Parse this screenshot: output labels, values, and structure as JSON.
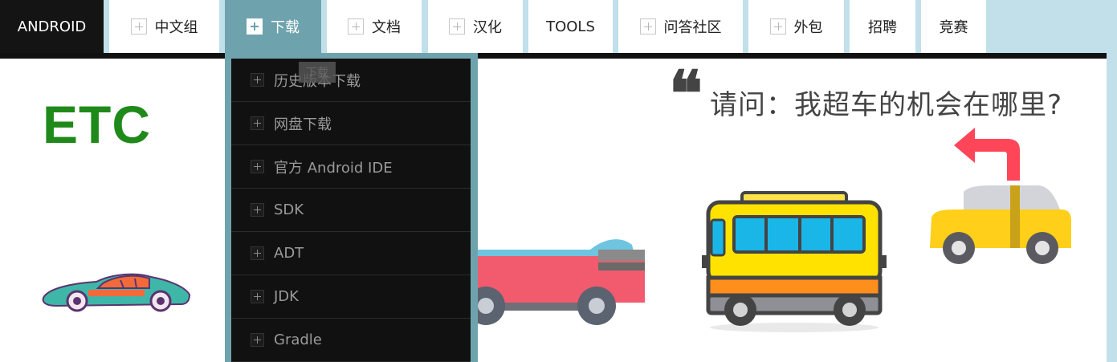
{
  "nav": {
    "brand": "ANDROID",
    "items": [
      {
        "label": "中文组",
        "icon": "plus-icon"
      },
      {
        "label": "下载",
        "icon": "plus-icon",
        "active": true
      },
      {
        "label": "文档",
        "icon": "plus-icon"
      },
      {
        "label": "汉化",
        "icon": "plus-icon"
      },
      {
        "label": "TOOLS"
      },
      {
        "label": "问答社区",
        "icon": "plus-icon"
      },
      {
        "label": "外包",
        "icon": "plus-icon"
      },
      {
        "label": "招聘"
      },
      {
        "label": "竞赛"
      }
    ]
  },
  "dropdown": {
    "tooltip": "下载",
    "items": [
      {
        "label": "历史版本下载"
      },
      {
        "label": "网盘下载"
      },
      {
        "label": "官方 Android IDE"
      },
      {
        "label": "SDK"
      },
      {
        "label": "ADT"
      },
      {
        "label": "JDK"
      },
      {
        "label": "Gradle"
      }
    ]
  },
  "banner": {
    "logo": "ETC",
    "slogan": "请问：我超车的机会在哪里?",
    "quote_mark": "❝"
  },
  "colors": {
    "active_tab": "#6ea3ad",
    "brand_bg": "#141414",
    "page_bg": "#c1e0ea",
    "logo_green": "#1f8a1a"
  }
}
